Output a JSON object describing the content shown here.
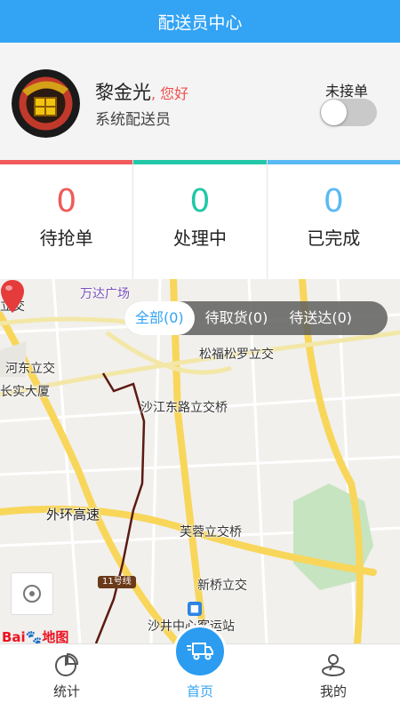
{
  "header": {
    "title": "配送员中心"
  },
  "profile": {
    "name": "黎金光",
    "greeting": ", 您好",
    "role": "系统配送员",
    "toggle_label": "未接单",
    "toggle_on": false
  },
  "stats": [
    {
      "value": "0",
      "label": "待抢单",
      "color": "#f05a5a"
    },
    {
      "value": "0",
      "label": "处理中",
      "color": "#22c7a8"
    },
    {
      "value": "0",
      "label": "已完成",
      "color": "#5ab9f4"
    }
  ],
  "filter_tabs": [
    {
      "label": "全部(0)",
      "active": true
    },
    {
      "label": "待取货(0)",
      "active": false
    },
    {
      "label": "待送达(0)",
      "active": false
    }
  ],
  "map": {
    "labels": {
      "wanda": "万达广场",
      "lijiao": "立交",
      "songfu": "松福松罗立交",
      "hedong": "河东立交",
      "changshi": "长实大厦",
      "shajiang": "沙江东路立交桥",
      "waihuan": "外环高速",
      "furong": "芙蓉立交桥",
      "xinqiao": "新桥立交",
      "station": "沙井中心客运站"
    },
    "line_badge": "11号线",
    "logo_text": "Bai",
    "logo_paw": "🐾",
    "logo_map": "地图"
  },
  "nav": [
    {
      "label": "统计",
      "icon": "pie-chart-icon"
    },
    {
      "label": "首页",
      "icon": "delivery-truck-icon"
    },
    {
      "label": "我的",
      "icon": "user-location-icon"
    }
  ],
  "colors": {
    "primary": "#33a3f4",
    "accent_red": "#f05a5a",
    "accent_green": "#22c7a8",
    "accent_blue": "#5ab9f4"
  }
}
